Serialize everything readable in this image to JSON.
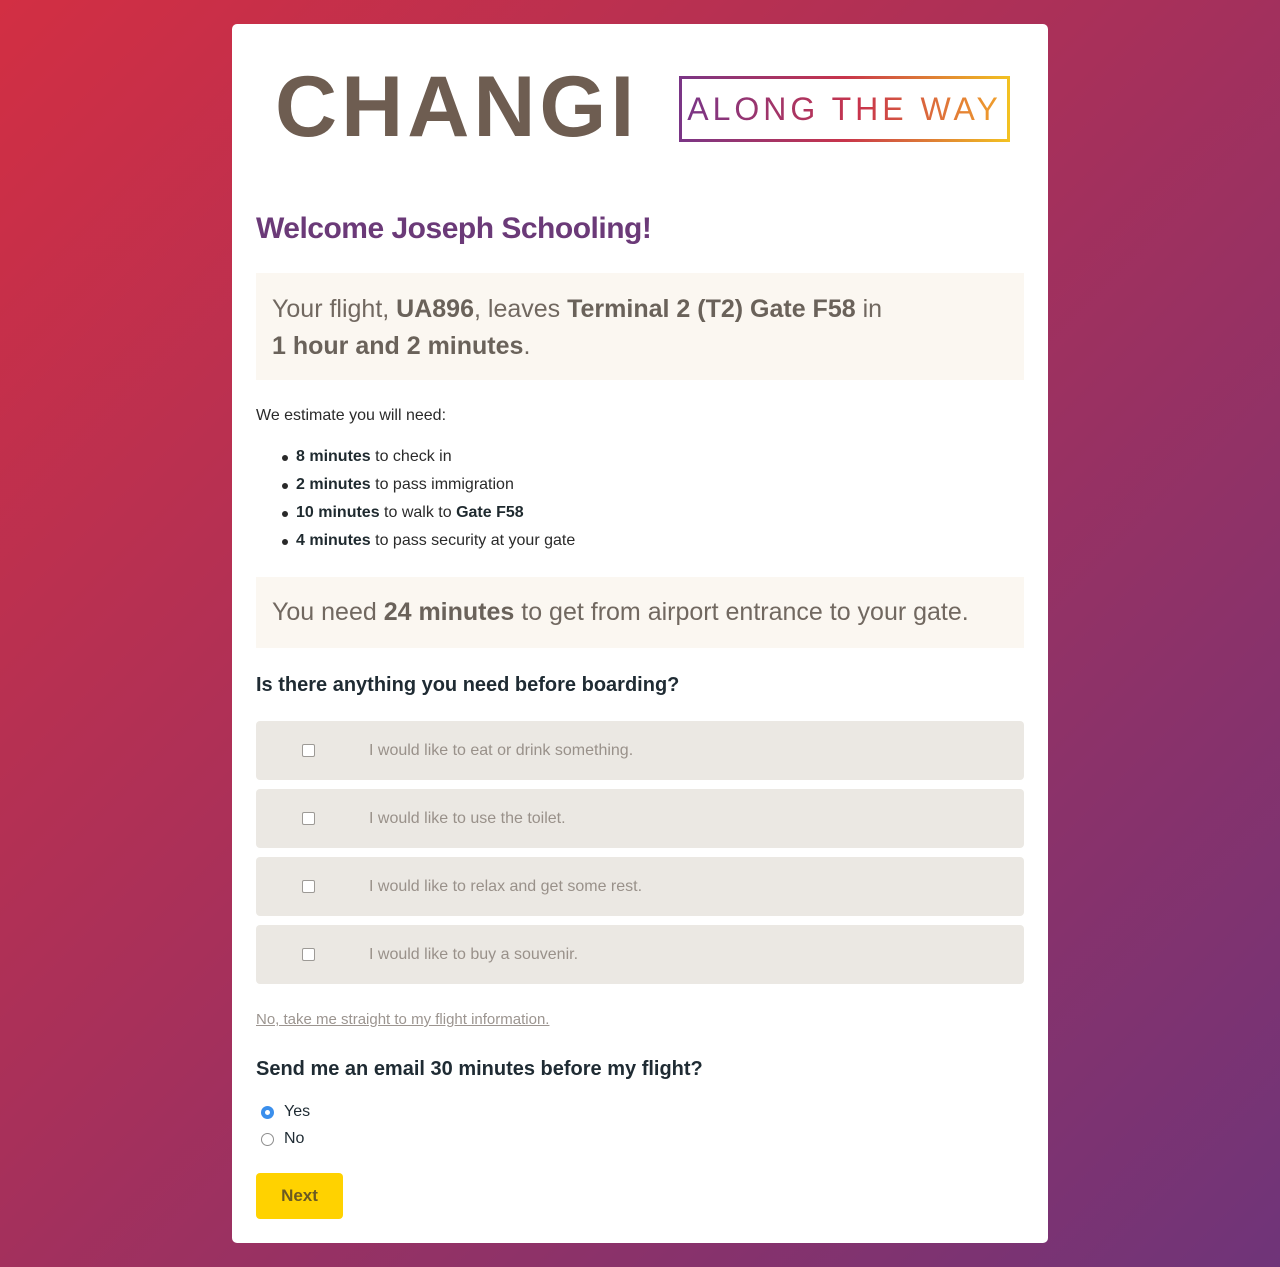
{
  "logo": {
    "wordmark": "CHANGI",
    "tagline": "ALONG THE WAY"
  },
  "welcome": "Welcome Joseph Schooling!",
  "flight": {
    "prefix": "Your flight, ",
    "number": "UA896",
    "mid": ", leaves ",
    "location": "Terminal 2 (T2) Gate F58",
    "suffix": " in",
    "time_left": "1 hour and 2 minutes",
    "end": "."
  },
  "estimate_intro": "We estimate you will need:",
  "estimates": [
    {
      "amount": "8 minutes",
      "text": " to check in",
      "extra": ""
    },
    {
      "amount": "2 minutes",
      "text": " to pass immigration",
      "extra": ""
    },
    {
      "amount": "10 minutes",
      "text": " to walk to ",
      "extra": "Gate F58"
    },
    {
      "amount": "4 minutes",
      "text": " to pass security at your gate",
      "extra": ""
    }
  ],
  "total": {
    "prefix": "You need ",
    "amount": "24 minutes",
    "suffix": " to get from airport entrance to your gate."
  },
  "needs_question": "Is there anything you need before boarding?",
  "needs_options": [
    {
      "label": "I would like to eat or drink something.",
      "checked": false
    },
    {
      "label": "I would like to use the toilet.",
      "checked": false
    },
    {
      "label": "I would like to relax and get some rest.",
      "checked": false
    },
    {
      "label": "I would like to buy a souvenir.",
      "checked": false
    }
  ],
  "skip_link": "No, take me straight to my flight information.",
  "email_question": "Send me an email 30 minutes before my flight?",
  "email_options": [
    {
      "label": "Yes",
      "selected": true
    },
    {
      "label": "No",
      "selected": false
    }
  ],
  "next_label": "Next",
  "colors": {
    "accent_purple": "#6b3a78",
    "button_yellow": "#ffd200",
    "radio_blue": "#3b8fec"
  }
}
